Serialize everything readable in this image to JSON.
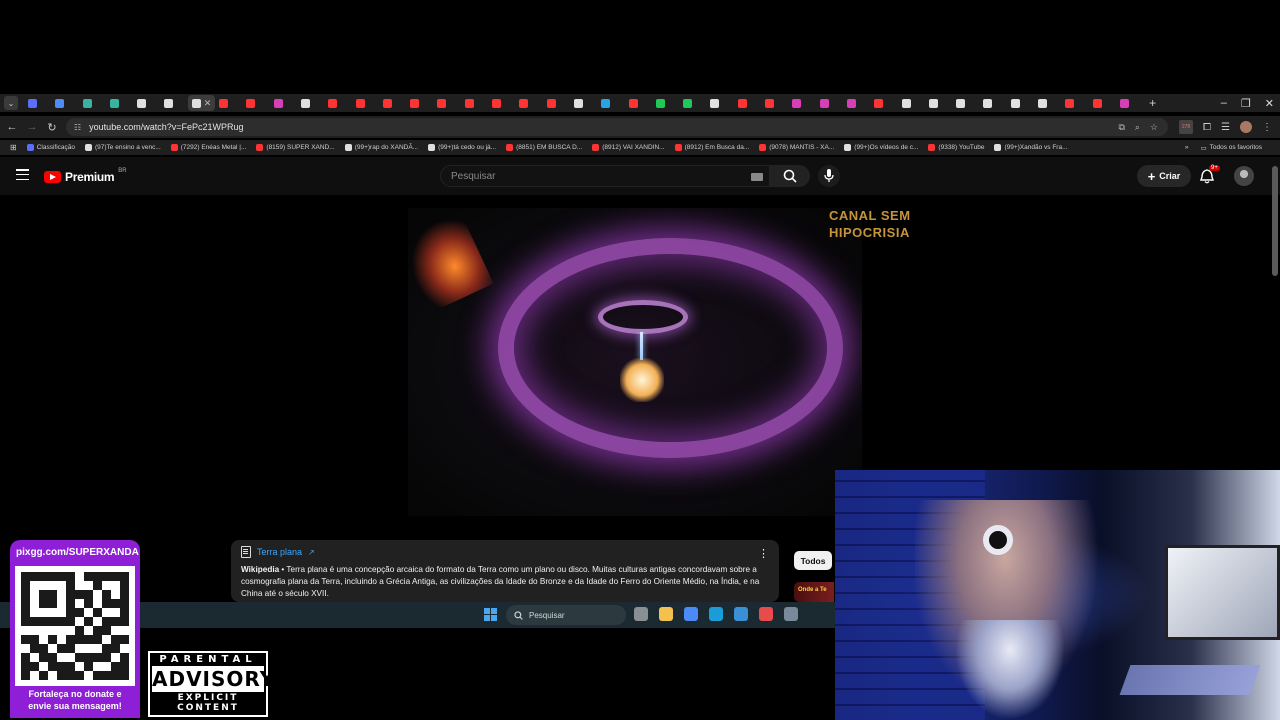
{
  "browser": {
    "tab_colors": [
      "#5b6ef5",
      "#4f8cf5",
      "#38b3a0",
      "#38b3a0",
      "#e0e0e0",
      "#e0e0e0",
      "#e0e0e0",
      "#ff3333",
      "#ff3333",
      "#d63fb6",
      "#e0e0e0",
      "#ff3333",
      "#ff3333",
      "#ff3333",
      "#ff3333",
      "#ff3333",
      "#ff3333",
      "#ff3333",
      "#ff3333",
      "#ff3333",
      "#e0e0e0",
      "#2aa3e3",
      "#ff3333",
      "#20c85a",
      "#20c85a",
      "#e0e0e0",
      "#ff3333",
      "#ff3333",
      "#d63fb6",
      "#d63fb6",
      "#d63fb6",
      "#ff3333",
      "#e0e0e0",
      "#e0e0e0",
      "#e0e0e0",
      "#e0e0e0",
      "#e0e0e0",
      "#e0e0e0",
      "#ff3333",
      "#ff3333",
      "#d63fb6"
    ],
    "active_tab_index": 6,
    "url": "youtube.com/watch?v=FePc21WPRug",
    "ext_badge": "278",
    "bookmarks": [
      {
        "label": "Classificação",
        "color": "#5b6ef5"
      },
      {
        "label": "(97)Te ensino a venc...",
        "color": "#e0e0e0"
      },
      {
        "label": "(7292) Enéas Metal |...",
        "color": "#ff3333"
      },
      {
        "label": "(8159) SUPER XAND...",
        "color": "#ff3333"
      },
      {
        "label": "(99+)rap do XANDÃ...",
        "color": "#e0e0e0"
      },
      {
        "label": "(99+)tá cedo ou já...",
        "color": "#e0e0e0"
      },
      {
        "label": "(8851) EM BUSCA D...",
        "color": "#ff3333"
      },
      {
        "label": "(8912) VAI XANDIN...",
        "color": "#ff3333"
      },
      {
        "label": "(8912) Em Busca da...",
        "color": "#ff3333"
      },
      {
        "label": "(9078) MANTIS - XA...",
        "color": "#ff3333"
      },
      {
        "label": "(99+)Os vídeos de c...",
        "color": "#e0e0e0"
      },
      {
        "label": "(9338) YouTube",
        "color": "#ff3333"
      },
      {
        "label": "(99+)Xandão vs Fra...",
        "color": "#e0e0e0"
      }
    ],
    "all_bookmarks_label": "Todos os favoritos"
  },
  "youtube": {
    "logo_text": "Premium",
    "country": "BR",
    "search_placeholder": "Pesquisar",
    "create_label": "Criar",
    "notif_count": "9+"
  },
  "video": {
    "watermark_line1": "CANAL SEM",
    "watermark_line2": "HIPOCRISIA"
  },
  "info_panel": {
    "title": "Terra plana",
    "source": "Wikipedia",
    "text": " • Terra plana é uma concepção arcaica do formato da Terra como um plano ou disco. Muitas culturas antigas concordavam sobre a cosmografia plana da Terra, incluindo a Grécia Antiga, as civilizações da Idade do Bronze e da Idade do Ferro do Oriente Médio, na Índia, e na China até o século XVII."
  },
  "chips": {
    "all": "Todos",
    "thumb_text": "Onde a Te"
  },
  "taskbar": {
    "search_placeholder": "Pesquisar",
    "app_colors": [
      "#8a8f94",
      "#f2c14e",
      "#4c8bf5",
      "#1b9bd8",
      "#3b8fd6",
      "#e84b4b",
      "#7a8a9a"
    ]
  },
  "overlay": {
    "donate_url": "pixgg.com/SUPERXANDA",
    "donate_message_line1": "Fortaleça no donate e",
    "donate_message_line2": "envie sua mensagem!",
    "advisory_top": "PARENTAL",
    "advisory_mid": "ADVISORY",
    "advisory_bottom": "EXPLICIT CONTENT"
  }
}
